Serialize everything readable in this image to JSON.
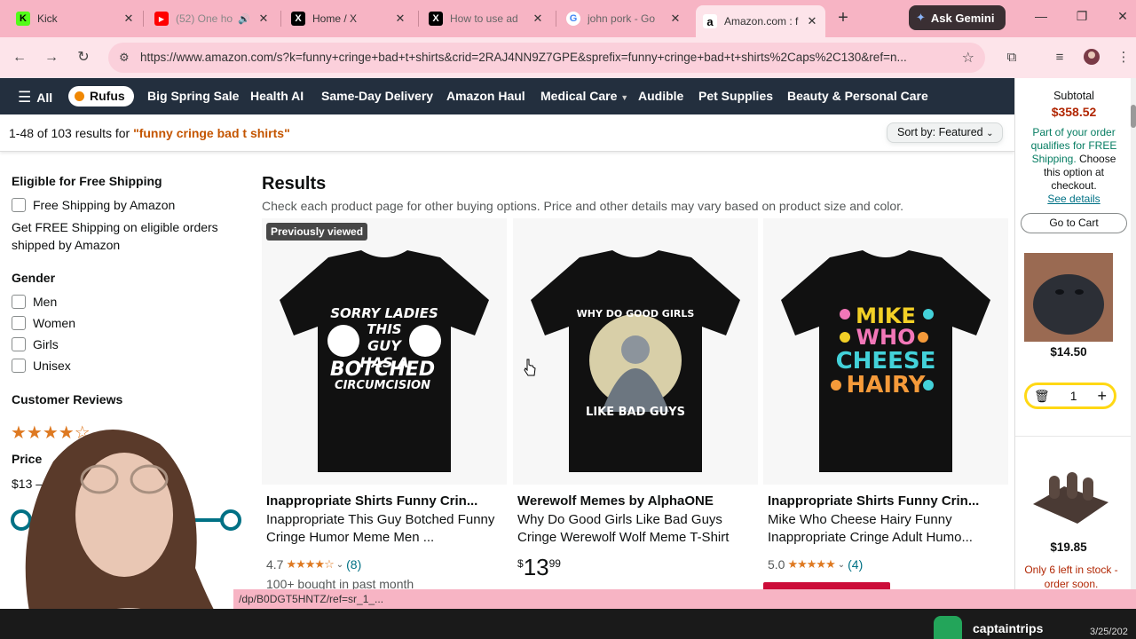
{
  "browser": {
    "tabs": [
      {
        "title": "Kick",
        "fav_letter": "K",
        "fav_color": "#53fc18",
        "fav_text": "#000"
      },
      {
        "title": "(52) One ho",
        "fav_letter": "▶",
        "fav_color": "#ff0000",
        "fav_text": "#fff",
        "audio": "🔊"
      },
      {
        "title": "Home / X",
        "fav_letter": "X",
        "fav_color": "#000000",
        "fav_text": "#fff"
      },
      {
        "title": "How to use ad",
        "fav_letter": "X",
        "fav_color": "#000000",
        "fav_text": "#fff"
      },
      {
        "title": "john pork - Go",
        "fav_letter": "G",
        "fav_color": "#ffffff",
        "fav_text": "#4285f4"
      },
      {
        "title": "Amazon.com : f",
        "fav_letter": "a",
        "fav_color": "#ffffff",
        "fav_text": "#000"
      }
    ],
    "gemini_label": "Ask Gemini",
    "url": "https://www.amazon.com/s?k=funny+cringe+bad+t+shirts&crid=2RAJ4NN9Z7GPE&sprefix=funny+cringe+bad+t+shirts%2Caps%2C130&ref=n..."
  },
  "amazon_nav": {
    "all_label": "All",
    "rufus_label": "Rufus",
    "items": [
      "Big Spring Sale",
      "Health AI",
      "Same-Day Delivery",
      "Amazon Haul",
      "Medical Care",
      "Audible",
      "Pet Supplies",
      "Beauty & Personal Care"
    ]
  },
  "results_bar": {
    "count_text": "1-48 of 103 results for ",
    "query": "\"funny cringe bad t shirts\"",
    "sort_label": "Sort by:",
    "sort_value": "Featured"
  },
  "filters": {
    "free_shipping_heading": "Eligible for Free Shipping",
    "free_shipping_option": "Free Shipping by Amazon",
    "free_shipping_note": "Get FREE Shipping on eligible orders shipped by Amazon",
    "gender_heading": "Gender",
    "gender_options": [
      "Men",
      "Women",
      "Girls",
      "Unisex"
    ],
    "reviews_heading": "Customer Reviews",
    "reviews_stars": "★★★★☆",
    "price_heading": "Price",
    "price_min": "$13 –"
  },
  "results": {
    "title": "Results",
    "subtitle": "Check each product page for other buying options. Price and other details may vary based on product size and color.",
    "products": [
      {
        "badge": "Previously viewed",
        "shirt_text": [
          "SORRY LADIES",
          "THIS",
          "GUY",
          "HAS A",
          "BOTCHED",
          "CIRCUMCISION"
        ],
        "brand": "Inappropriate Shirts Funny Crin...",
        "title": "Inappropriate This Guy Botched Funny Cringe Humor Meme Men ...",
        "rating": "4.7",
        "stars": "★★★★☆",
        "review_count": "(8)",
        "bought": "100+ bought in past month"
      },
      {
        "shirt_text": [
          "WHY DO GOOD GIRLS",
          "LIKE BAD GUYS"
        ],
        "brand": "Werewolf Memes by AlphaONE",
        "title": "Why Do Good Girls Like Bad Guys Cringe Werewolf Wolf Meme T-Shirt",
        "price_symbol": "$",
        "price_whole": "13",
        "price_fraction": "99"
      },
      {
        "shirt_text": [
          "MIKE",
          "WHO",
          "CHEESE",
          "HAIRY"
        ],
        "brand": "Inappropriate Shirts Funny Crin...",
        "title": "Mike Who Cheese Hairy Funny Inappropriate Cringe Adult Humo...",
        "rating": "5.0",
        "stars": "★★★★★",
        "review_count": "(4)"
      }
    ]
  },
  "cart": {
    "subtotal_label": "Subtotal",
    "subtotal": "$358.52",
    "free_ship_green": "Part of your order qualifies for FREE Shipping.",
    "free_ship_rest": "Choose this option at checkout.",
    "see_details": "See details",
    "go_to_cart": "Go to Cart",
    "item1_price": "$14.50",
    "item1_qty": "1",
    "item2_price": "$19.85",
    "item2_stock": "Only 6 left in stock - order soon."
  },
  "status_url": "/dp/B0DGT5HNTZ/ref=sr_1_...",
  "stream": {
    "name": "captaintrips",
    "date": "3/25/202"
  },
  "colors": {
    "chrome_pink": "#f7b4c4",
    "amazon_nav": "#232f3e",
    "price_red": "#b12704",
    "link_teal": "#007185",
    "star_orange": "#de7921"
  }
}
